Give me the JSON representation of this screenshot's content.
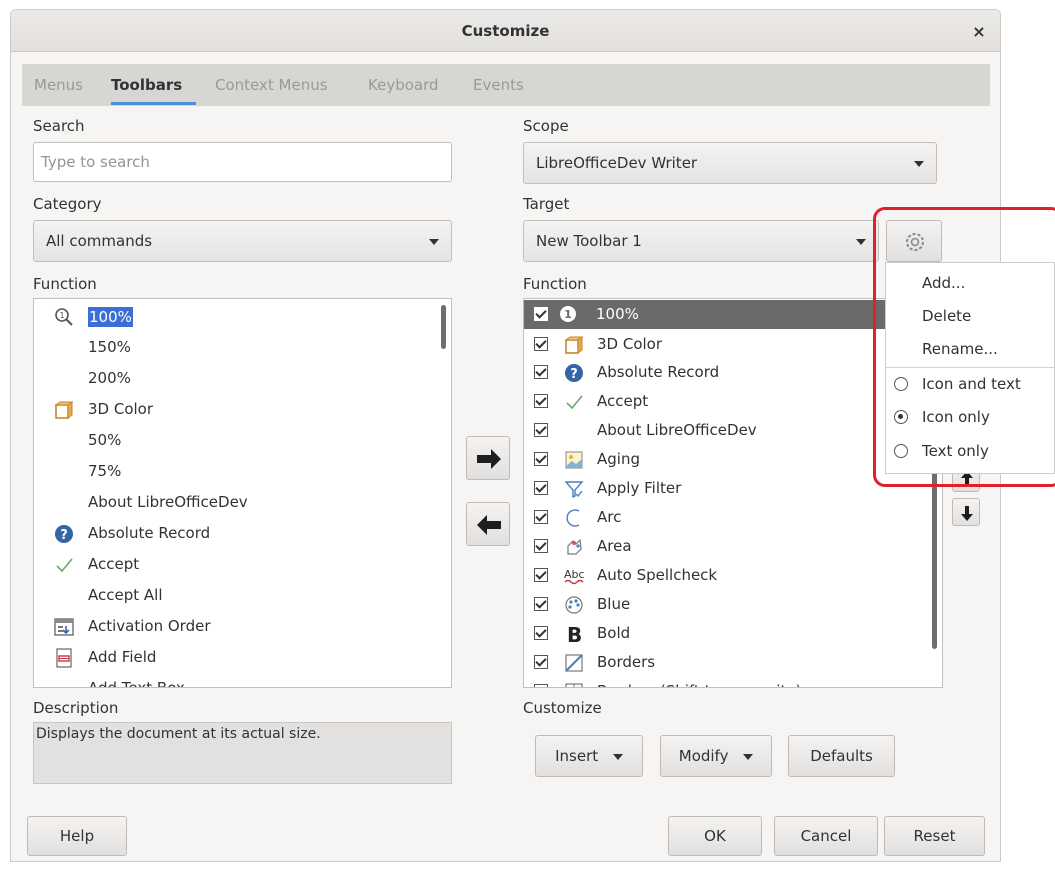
{
  "dialog": {
    "title": "Customize",
    "close": "×"
  },
  "tabs": [
    "Menus",
    "Toolbars",
    "Context Menus",
    "Keyboard",
    "Events"
  ],
  "search": {
    "label": "Search",
    "placeholder": "Type to search"
  },
  "category": {
    "label": "Category",
    "value": "All commands"
  },
  "scope": {
    "label": "Scope",
    "value": "LibreOfficeDev Writer"
  },
  "target": {
    "label": "Target",
    "value": "New Toolbar 1"
  },
  "left_function": {
    "label": "Function",
    "items": [
      "100%",
      "150%",
      "200%",
      "3D Color",
      "50%",
      "75%",
      "About LibreOfficeDev",
      "Absolute Record",
      "Accept",
      "Accept All",
      "Activation Order",
      "Add Field",
      "Add Text Box"
    ]
  },
  "right_function": {
    "label": "Function",
    "items": [
      "100%",
      "3D Color",
      "Absolute Record",
      "Accept",
      "About LibreOfficeDev",
      "Aging",
      "Apply Filter",
      "Arc",
      "Area",
      "Auto Spellcheck",
      "Blue",
      "Bold",
      "Borders",
      "Borders (Shift to overwrite)"
    ]
  },
  "description": {
    "label": "Description",
    "text": "Displays the document at its actual size."
  },
  "customize": {
    "label": "Customize",
    "insert": "Insert",
    "modify": "Modify",
    "defaults": "Defaults"
  },
  "footer": {
    "help": "Help",
    "ok": "OK",
    "cancel": "Cancel",
    "reset": "Reset"
  },
  "gear_menu": {
    "add": "Add...",
    "delete": "Delete",
    "rename": "Rename...",
    "icon_and_text": "Icon and text",
    "icon_only": "Icon only",
    "text_only": "Text only",
    "selected_mode": "Icon only"
  },
  "colors": {
    "selection": "#6a6a6a",
    "highlight_text": "#3c6fd6",
    "accent": "#4a90d9",
    "annotation": "#e0202a"
  }
}
